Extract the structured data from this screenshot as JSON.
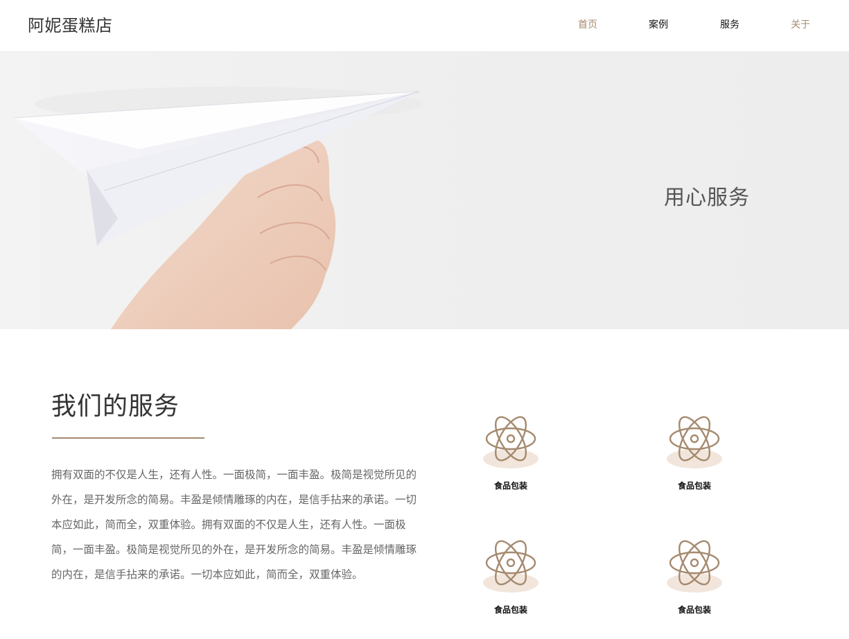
{
  "header": {
    "brand": "阿妮蛋糕店",
    "nav": [
      "首页",
      "案例",
      "服务",
      "关于"
    ]
  },
  "hero": {
    "title": "用心服务"
  },
  "services": {
    "title": "我们的服务",
    "description": "拥有双面的不仅是人生，还有人性。一面极简，一面丰盈。极简是视觉所见的外在，是开发所念的简易。丰盈是倾情雕琢的内在，是信手拈来的承诺。一切本应如此，简而全，双重体验。拥有双面的不仅是人生，还有人性。一面极简，一面丰盈。极简是视觉所见的外在，是开发所念的简易。丰盈是倾情雕琢的内在，是信手拈来的承诺。一切本应如此，简而全，双重体验。",
    "items": [
      {
        "label": "食品包装",
        "icon": "atom-icon"
      },
      {
        "label": "食品包装",
        "icon": "atom-icon"
      },
      {
        "label": "食品包装",
        "icon": "atom-icon"
      },
      {
        "label": "食品包装",
        "icon": "atom-icon"
      }
    ]
  },
  "colors": {
    "accent": "#a58a6f",
    "icon_shadow": "#f2e6dc"
  }
}
